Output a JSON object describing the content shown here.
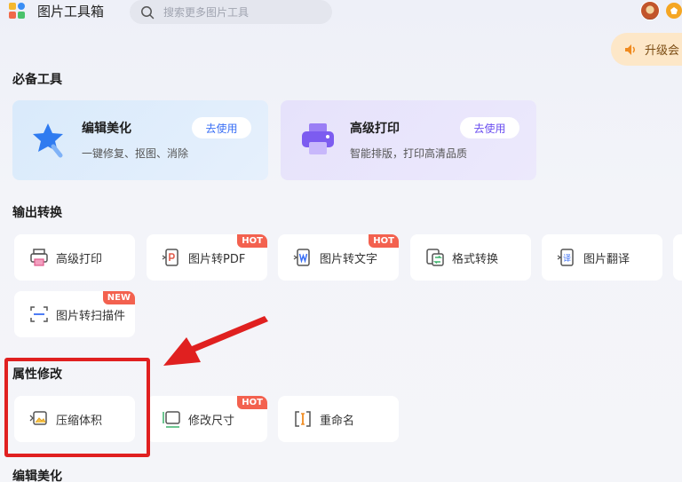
{
  "header": {
    "app_title": "图片工具箱",
    "search_placeholder": "搜索更多图片工具",
    "upgrade_label": "升级会"
  },
  "sections": {
    "essential": "必备工具",
    "output": "输出转换",
    "attributes": "属性修改",
    "beautify": "编辑美化"
  },
  "big_cards": [
    {
      "title": "编辑美化",
      "desc": "一键修复、抠图、消除",
      "button": "去使用"
    },
    {
      "title": "高级打印",
      "desc": "智能排版，打印高清品质",
      "button": "去使用"
    }
  ],
  "output_tools": [
    {
      "label": "高级打印",
      "tag": ""
    },
    {
      "label": "图片转PDF",
      "tag": "HOT"
    },
    {
      "label": "图片转文字",
      "tag": "HOT"
    },
    {
      "label": "格式转换",
      "tag": ""
    },
    {
      "label": "图片翻译",
      "tag": ""
    },
    {
      "label": "图片转扫描件",
      "tag": "NEW"
    }
  ],
  "attribute_tools": [
    {
      "label": "压缩体积",
      "tag": ""
    },
    {
      "label": "修改尺寸",
      "tag": "HOT"
    },
    {
      "label": "重命名",
      "tag": ""
    }
  ],
  "colors": {
    "accent": "#3a6ff5",
    "tag_red": "#f3614f",
    "highlight_red": "#e02020"
  },
  "icons": {
    "search": "search-icon",
    "speaker": "speaker-icon",
    "star_wand": "magic-wand-icon",
    "printer": "printer-icon"
  }
}
